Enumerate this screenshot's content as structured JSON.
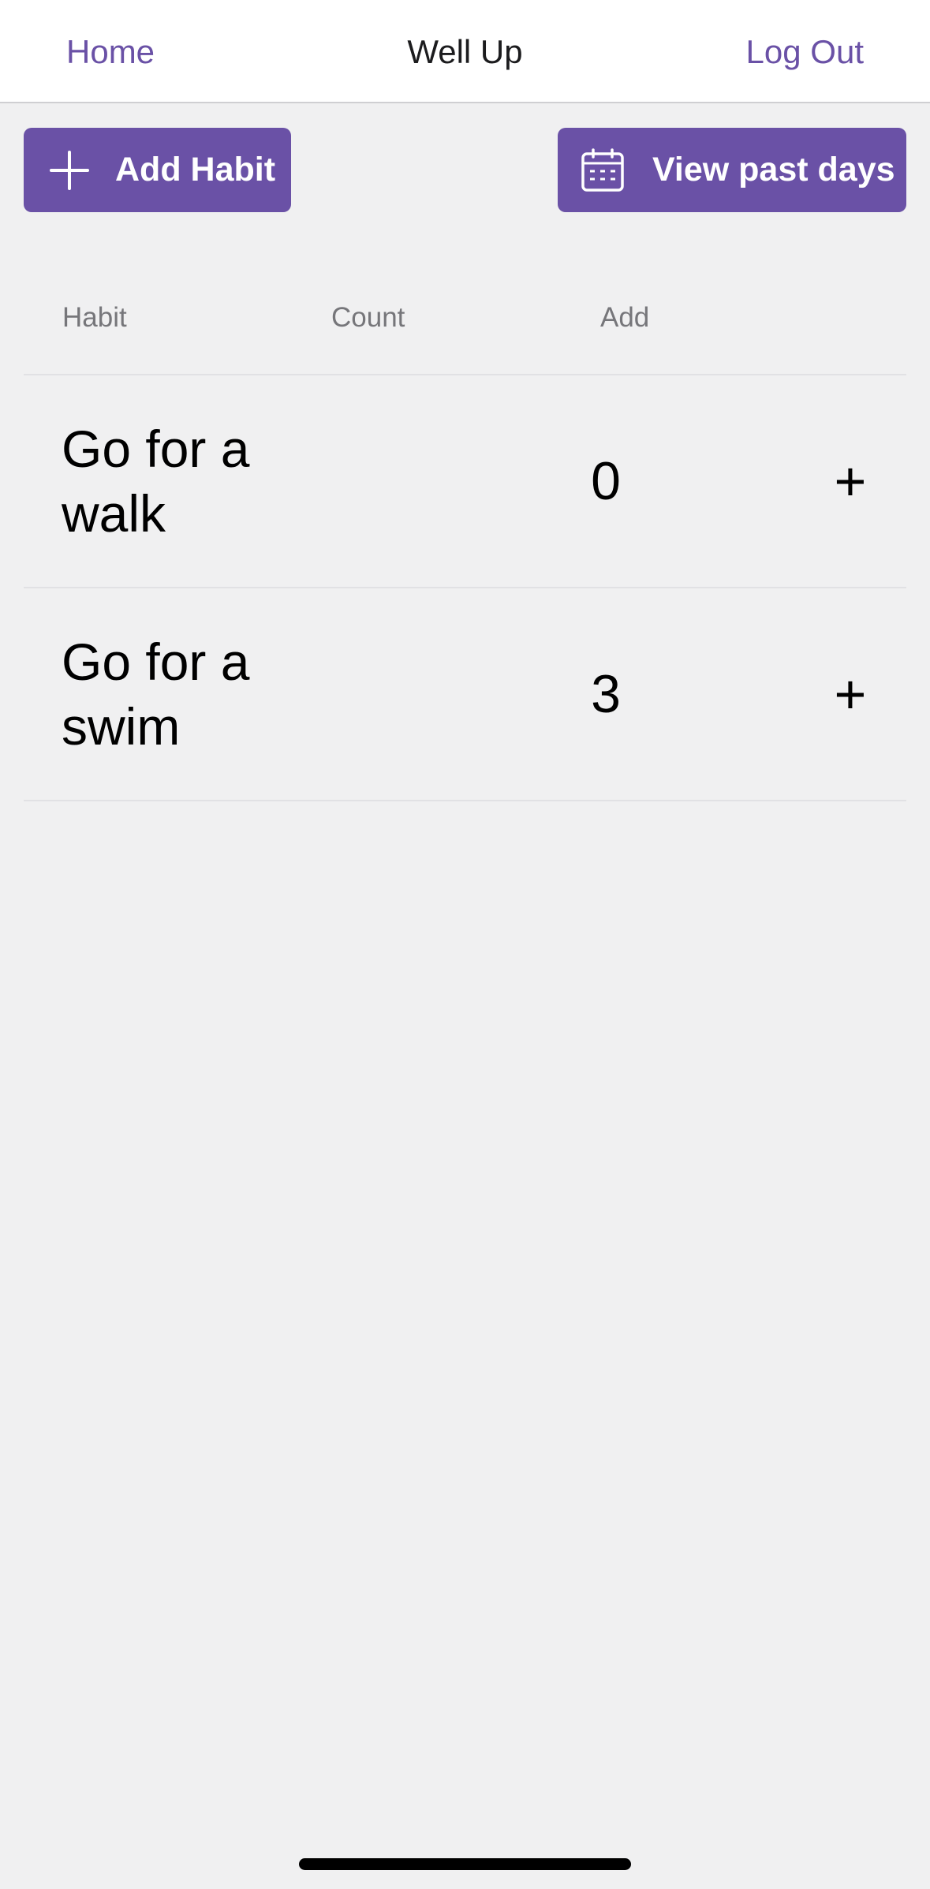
{
  "navbar": {
    "home_label": "Home",
    "title": "Well Up",
    "logout_label": "Log Out"
  },
  "toolbar": {
    "add_habit_label": "Add Habit",
    "add_habit_icon": "plus-icon",
    "view_past_days_label": "View past days",
    "view_past_days_icon": "calendar-icon"
  },
  "table": {
    "headers": {
      "habit": "Habit",
      "count": "Count",
      "add": "Add"
    },
    "rows": [
      {
        "habit": "Go for a walk",
        "count": "0",
        "add": "+"
      },
      {
        "habit": "Go for a swim",
        "count": "3",
        "add": "+"
      }
    ]
  },
  "colors": {
    "accent": "#6a51a6",
    "background": "#f0f0f1",
    "navbar_background": "#ffffff"
  }
}
